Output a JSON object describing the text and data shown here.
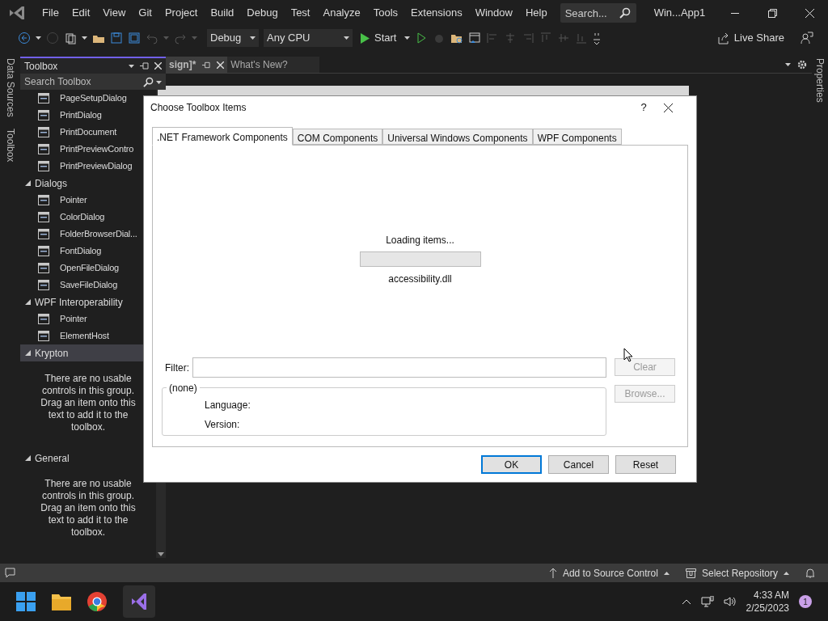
{
  "menu": [
    "File",
    "Edit",
    "View",
    "Git",
    "Project",
    "Build",
    "Debug",
    "Test",
    "Analyze",
    "Tools",
    "Extensions",
    "Window",
    "Help"
  ],
  "search": {
    "placeholder": "Search..."
  },
  "window": {
    "title": "Win...App1"
  },
  "toolbar": {
    "configuration": "Debug",
    "platform": "Any CPU",
    "start": "Start",
    "live_share": "Live Share"
  },
  "side_tabs": [
    "Data Sources",
    "Toolbox"
  ],
  "right_tabs": [
    "Properties"
  ],
  "toolbox": {
    "title": "Toolbox",
    "search_placeholder": "Search Toolbox",
    "groups": [
      {
        "items": [
          "PageSetupDialog",
          "PrintDialog",
          "PrintDocument",
          "PrintPreviewContro",
          "PrintPreviewDialog"
        ]
      },
      {
        "name": "Dialogs",
        "expanded": true,
        "selected": false,
        "items": [
          "Pointer",
          "ColorDialog",
          "FolderBrowserDial...",
          "FontDialog",
          "OpenFileDialog",
          "SaveFileDialog"
        ]
      },
      {
        "name": "WPF Interoperability",
        "expanded": true,
        "selected": false,
        "items": [
          "Pointer",
          "ElementHost"
        ]
      },
      {
        "name": "Krypton",
        "expanded": true,
        "selected": true,
        "message": "There are no usable controls in this group. Drag an item onto this text to add it to the toolbox."
      },
      {
        "name": "General",
        "expanded": true,
        "selected": false,
        "message": "There are no usable controls in this group. Drag an item onto this text to add it to the toolbox."
      }
    ]
  },
  "editor_tabs": [
    {
      "label": "sign]*",
      "selected": true
    },
    {
      "label": "What's New?",
      "selected": false
    }
  ],
  "dialog": {
    "title": "Choose Toolbox Items",
    "help": "?",
    "tabs": [
      {
        "label": ".NET Framework Components",
        "selected": true
      },
      {
        "label": "COM Components",
        "selected": false
      },
      {
        "label": "Universal Windows Components",
        "selected": false
      },
      {
        "label": "WPF Components",
        "selected": false
      }
    ],
    "loading": "Loading items...",
    "progress": {
      "level": 0
    },
    "file": "accessibility.dll",
    "filter_label": "Filter:",
    "side_buttons": [
      {
        "label": "Clear",
        "disabled": true
      },
      {
        "label": "Browse...",
        "disabled": true
      }
    ],
    "details": {
      "title": "(none)",
      "lines": [
        "Language:",
        "Version:"
      ]
    },
    "buttons": [
      {
        "label": "OK",
        "default": true
      },
      {
        "label": "Cancel",
        "default": false
      },
      {
        "label": "Reset",
        "default": false
      }
    ]
  },
  "status_bar": {
    "items": [
      "Add to Source Control",
      "Select Repository"
    ]
  },
  "taskbar": {
    "time": "4:33 AM",
    "date": "2/25/2023",
    "notifications": "1"
  }
}
